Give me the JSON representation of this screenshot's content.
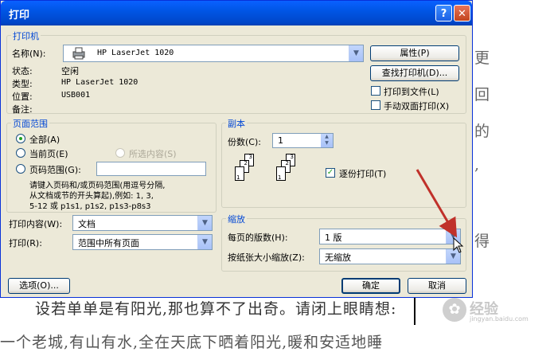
{
  "dialog": {
    "title": "打印",
    "help_label": "?",
    "close_label": "✕"
  },
  "printer": {
    "group_title": "打印机",
    "name_label": "名称(N):",
    "name_value": "HP LaserJet 1020",
    "status_label": "状态:",
    "status_value": "空闲",
    "type_label": "类型:",
    "type_value": "HP LaserJet 1020",
    "location_label": "位置:",
    "location_value": "USB001",
    "comment_label": "备注:",
    "properties_button": "属性(P)",
    "find_button": "查找打印机(D)...",
    "print_to_file": "打印到文件(L)",
    "manual_duplex": "手动双面打印(X)"
  },
  "page_range": {
    "group_title": "页面范围",
    "all": "全部(A)",
    "current": "当前页(E)",
    "selection": "所选内容(S)",
    "pages": "页码范围(G):",
    "hint_line1": "请键入页码和/或页码范围(用逗号分隔,",
    "hint_line2": "从文档或节的开头算起),例如: 1, 3,",
    "hint_line3": "5-12 或 p1s1, p1s2, p1s3-p8s3"
  },
  "copies": {
    "group_title": "副本",
    "count_label": "份数(C):",
    "count_value": "1",
    "collate_label": "逐份打印(T)",
    "page_numbers": [
      "3",
      "2",
      "1"
    ]
  },
  "print_what": {
    "label": "打印内容(W):",
    "value": "文档"
  },
  "print_option": {
    "label": "打印(R):",
    "value": "范围中所有页面"
  },
  "zoom": {
    "group_title": "缩放",
    "pages_per_sheet_label": "每页的版数(H):",
    "pages_per_sheet_value": "1 版",
    "scale_label": "按纸张大小缩放(Z):",
    "scale_value": "无缩放"
  },
  "footer": {
    "options_button": "选项(O)...",
    "ok_button": "确定",
    "cancel_button": "取消"
  },
  "background": {
    "side_chars": [
      "更",
      "回",
      "的",
      ",",
      "得"
    ],
    "line1": "设若单单是有阳光,那也算不了出奇。请闭上眼睛想:",
    "line2": "一个老城,有山有水,全在天底下晒着阳光,暖和安适地睡",
    "watermark_text": "经验",
    "watermark_sub": "jingyan.baidu.com"
  }
}
